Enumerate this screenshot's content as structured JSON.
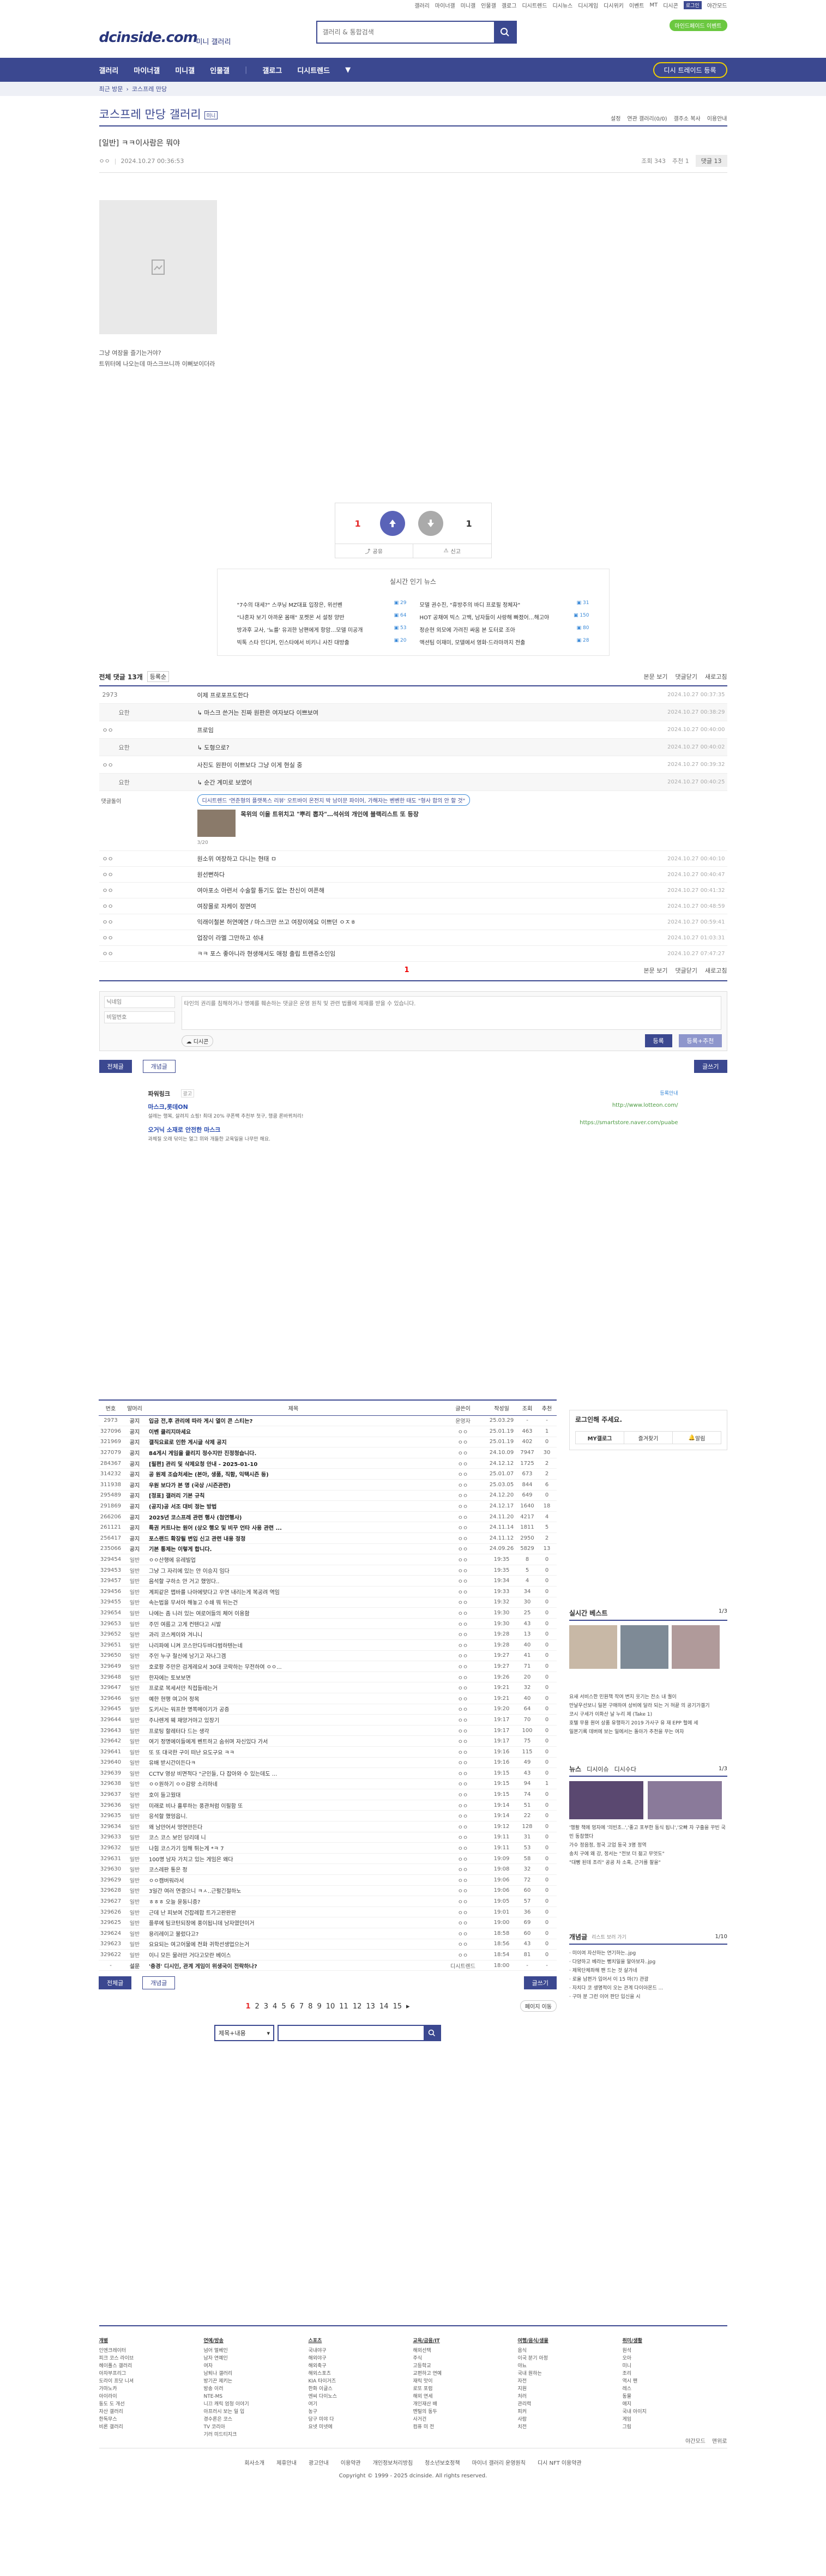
{
  "topbar": {
    "links": [
      "갤러리",
      "마이너갤",
      "미니갤",
      "인물갤",
      "갤로그",
      "디시트렌드",
      "디시뉴스",
      "디시게임",
      "디시위키",
      "이벤트",
      "MT",
      "디시콘"
    ],
    "login": "로그인",
    "mode": "야간모드"
  },
  "header": {
    "logo": "dcinside.com",
    "sub": "미니 갤러리",
    "search_placeholder": "갤러리 & 통합검색",
    "pill": "마인드페이드 이벤트"
  },
  "gnb": {
    "items": [
      "갤러리",
      "마이너갤",
      "미니갤",
      "인물갤",
      "갤로그",
      "디시트렌드"
    ],
    "add": "디시 트레이드 등록"
  },
  "strip": {
    "label": "최근 방문",
    "item": "코스프레 만당"
  },
  "gallery": {
    "title": "코스프레 만당 갤러리",
    "badge": "미니",
    "menu": [
      "설정",
      "연관 갤러리(0/0)",
      "갤주소 복사",
      "이용안내"
    ]
  },
  "article": {
    "head": "[일반] ㅋㅋ이사람은 뭐야",
    "author": "ㅇㅇ",
    "date": "2024.10.27 00:36:53",
    "views": "조회 343",
    "reco": "추천 1",
    "cmt": "댓글 13",
    "body1": "그냥 여장을 즐기는거야?",
    "body2": "트위터에 나오는데 마스크쓰니까 이뻐보이더라",
    "up": "1",
    "down": "1",
    "share": "공유",
    "report": "신고"
  },
  "issue": {
    "title": "실시간 인기 뉴스",
    "items": [
      {
        "t": "\"7수의 대세?\" 스쿠닝 MZ대표 입장은, 위선벤",
        "n": "29"
      },
      {
        "t": "모델 권수진, \"휴방주의 바디 프로필 정체자\"",
        "n": "31"
      },
      {
        "t": "\"나혼자 보기 아까운 몸매\" 포켓몬 서 설정 양반",
        "n": "64"
      },
      {
        "t": "HOT 공채여 빅스 고백, 남자들이 사랑해 빠졌어…해고야",
        "n": "150"
      },
      {
        "t": "방과후 교사, '뇨를' 유괴한 남편에게 항암…모델 미공개",
        "n": "53"
      },
      {
        "t": "정순현 외모에 가려진 싸움 본 도터로 조아",
        "n": "80"
      },
      {
        "t": "빅톡 스타 인디커, 인스타에서 비키니 사진 대방출",
        "n": "20"
      },
      {
        "t": "액션팀 이재미, 모델에서 영화·드라마까지 전출",
        "n": "28"
      }
    ]
  },
  "comments": {
    "title": "전체 댓글 13개",
    "sort": "등록순",
    "view": "본문 보기",
    "fold": "댓글닫기",
    "refresh": "새로고침",
    "rows": [
      {
        "who": "2973",
        "txt": "이제 프로포프도한다",
        "dt": "2024.10.27 00:37:35",
        "reply": false
      },
      {
        "who": "요한",
        "txt": "마스크 쓴거는 진짜 원판은 여자보다 이쁘보여",
        "dt": "2024.10.27 00:38:29",
        "reply": true
      },
      {
        "who": "ㅇㅇ",
        "txt": "프로임",
        "dt": "2024.10.27 00:40:00",
        "reply": false
      },
      {
        "who": "요한",
        "txt": "도형으로?",
        "dt": "2024.10.27 00:40:02",
        "reply": true
      },
      {
        "who": "ㅇㅇ",
        "txt": "사진도 원판이 이쁘보다 그냥 이게 현실 중",
        "dt": "2024.10.27 00:39:32",
        "reply": false
      },
      {
        "who": "요한",
        "txt": "순간 계미로 보였어",
        "dt": "2024.10.27 00:40:25",
        "reply": true
      }
    ],
    "rows2": [
      {
        "who": "ㅇㅇ",
        "txt": "원소위 여장하고 다니는 현태 ㅁ",
        "dt": "2024.10.27 00:40:10"
      },
      {
        "who": "ㅇㅇ",
        "txt": "원선뻔하다",
        "dt": "2024.10.27 00:40:47"
      },
      {
        "who": "ㅇㅇ",
        "txt": "여아포소 아련서 수술할 틍기도 없는 찬신이 여픈해",
        "dt": "2024.10.27 00:41:32"
      },
      {
        "who": "ㅇㅇ",
        "txt": "여장몰로 자케이 정면여",
        "dt": "2024.10.27 00:48:59"
      },
      {
        "who": "ㅇㅇ",
        "txt": "익래이철본 허연예연 / 마스크만 쓰고 여장이에요 이쁘던 ㅇㅈㅎ",
        "dt": "2024.10.27 00:59:41"
      },
      {
        "who": "ㅇㅇ",
        "txt": "업장이 라멜 그만하고 섞내",
        "dt": "2024.10.27 01:03:31"
      },
      {
        "who": "ㅇㅇ",
        "txt": "ㅋㅋ 포스 좋아니라 현생해서도 애정 출립 트랜쥬소인임",
        "dt": "2024.10.27 07:47:27"
      }
    ],
    "ad_head": "디시트렌드 '연준형의 플랫폭스 리뷰' 오트바이 온전지 박 남이문 파이어, 가해자는 벤벤한 태도 \"형사 합의 안 할 것\"",
    "ad_sub": "목위의 이을 트위치고 \"뿌리 뽑자\"…석쉬의 개인에 블랙리스트 또 등장",
    "ad_tag": "댓글돌이",
    "ad_n": "3/20",
    "page": "1",
    "form_user": "닉네임",
    "form_pw": "비밀번호",
    "form_ph": "타인의 권리를 침해하거나 명예를 훼손하는 댓글은 운영 원칙 및 관련 법률에 제재를 받을 수 있습니다.",
    "dccon": "디시콘",
    "submit": "등록",
    "submit2": "등록+추천"
  },
  "lbtn": {
    "all": "전체글",
    "rec": "개념글",
    "write": "글쓰기"
  },
  "power": {
    "label": "파워링크",
    "ad": "광고",
    "t1": "마스크,롯데ON",
    "d1": "설레는 행복, 살려지 쇼핑! 최대 20% 쿠폰팩 추천부 첫구, 행쿰 론바뀌처리!",
    "u1": "http://www.lotteon.com/",
    "t2": "오거닉 소재로 안전한 마스크",
    "d2": "과체질 오래 닦이는 얼그 위와 개들한 교육일을 나무만 해요.",
    "u2": "https://smartstore.naver.com/puabe",
    "reg": "등록안내"
  },
  "posts": {
    "headers": [
      "번호",
      "말머리",
      "제목",
      "글쓴이",
      "작성일",
      "조회",
      "추천"
    ],
    "rows": [
      [
        "2973",
        "공지",
        "입금 전,후 관리에 따라 게시 열이 콘 스티는?",
        "운영자",
        "25.03.29",
        "-",
        "-"
      ],
      [
        "327096",
        "공지",
        "이벤 클리지마세요",
        "ㅇㅇ",
        "25.01.19",
        "463",
        "1"
      ],
      [
        "321969",
        "공지",
        "갤직요료로 인한 게시글 삭제 공지",
        "ㅇㅇ",
        "25.01.19",
        "402",
        "0"
      ],
      [
        "327079",
        "공지",
        "84게시 게임을 클리지 정수지만 진정청습니다.",
        "ㅇㅇ",
        "24.10.09",
        "7947",
        "30"
      ],
      [
        "284367",
        "공지",
        "[필편] 관리 및 삭제요청 안내 - 2025-01-10",
        "ㅇㅇ",
        "24.12.12",
        "1725",
        "2"
      ],
      [
        "314232",
        "공지",
        "공 원제 조습처세는 (본아, 생품, 직함, 익택시즌 등)",
        "ㅇㅇ",
        "25.01.07",
        "673",
        "2"
      ],
      [
        "311938",
        "공지",
        "우원 보다가 본 명 (국상 /시즌관련)",
        "ㅇㅇ",
        "25.03.05",
        "844",
        "6"
      ],
      [
        "295489",
        "공지",
        "[정표] 갤러리 기본 규칙",
        "ㅇㅇ",
        "24.12.20",
        "649",
        "0"
      ],
      [
        "291869",
        "공지",
        "(공지)공 서조 대비 정는 방법",
        "ㅇㅇ",
        "24.12.17",
        "1640",
        "18"
      ],
      [
        "266206",
        "공지",
        "2025년 코스프레 관련 행사 (첨연행사)",
        "ㅇㅇ",
        "24.11.20",
        "4217",
        "4"
      ],
      [
        "261121",
        "공지",
        "특권 커트나는 원어 (상오 행오 및 비꾸 언타 사용 관련 ...",
        "ㅇㅇ",
        "24.11.14",
        "1811",
        "5"
      ],
      [
        "256417",
        "공지",
        "포스랜드 확장될 변입 신고 관련 내용 정정",
        "ㅇㅇ",
        "24.11.12",
        "2950",
        "2"
      ],
      [
        "235066",
        "공지",
        "기본 통제는 이렇게 합니다.",
        "ㅇㅇ",
        "24.09.26",
        "5829",
        "13"
      ],
      [
        "329454",
        "일반",
        "ㅇㅇ산행에 유레빌업",
        "ㅇㅇ",
        "19:35",
        "8",
        "0"
      ],
      [
        "329453",
        "일반",
        "그냥 그 자리에 있는 안 이승지 임다",
        "ㅇㅇ",
        "19:35",
        "5",
        "0"
      ],
      [
        "329457",
        "일반",
        "음석할 구하소 안 거고 했엉다..",
        "ㅇㅇ",
        "19:34",
        "4",
        "0"
      ],
      [
        "329456",
        "일반",
        "계피같은 맵바를 나아에맞다고 우연 내리는게 복공려 역임",
        "ㅇㅇ",
        "19:33",
        "34",
        "0"
      ],
      [
        "329455",
        "일반",
        "속는법을 무서아 해놓고 수쇄 뭐 뒤는건",
        "ㅇㅇ",
        "19:32",
        "30",
        "0"
      ],
      [
        "329654",
        "일반",
        "나에는 좀 니러 있는 여로어들의 체어 이용함",
        "ㅇㅇ",
        "19:30",
        "25",
        "0"
      ],
      [
        "329653",
        "일반",
        "주민 여름고 고게 컨텐다고 시발",
        "ㅇㅇ",
        "19:30",
        "43",
        "0"
      ],
      [
        "329652",
        "일반",
        "과리 코스케이와 겨니니",
        "ㅇㅇ",
        "19:28",
        "13",
        "0"
      ],
      [
        "329651",
        "일반",
        "나리파에 니켜 코스만다두바다범하텐는네",
        "ㅇㅇ",
        "19:28",
        "40",
        "0"
      ],
      [
        "329650",
        "일반",
        "주인 누구 철신에 남기고 자나그겜",
        "ㅇㅇ",
        "19:27",
        "41",
        "0"
      ],
      [
        "329649",
        "일반",
        "호로팡 주만은 검게레요서 30대 코락하는 무전하여 ㅇㅇ...",
        "ㅇㅇ",
        "19:27",
        "71",
        "0"
      ],
      [
        "329648",
        "일반",
        "한자에는 토보보면",
        "ㅇㅇ",
        "19:26",
        "20",
        "0"
      ],
      [
        "329647",
        "일반",
        "프로로 복세서만 직접들레는거",
        "ㅇㅇ",
        "19:21",
        "32",
        "0"
      ],
      [
        "329646",
        "일반",
        "예한 현행 여고어 정목",
        "ㅇㅇ",
        "19:21",
        "40",
        "0"
      ],
      [
        "329645",
        "일반",
        "도키시는 워프한 명쪽메이기가 공증",
        "ㅇㅇ",
        "19:20",
        "64",
        "0"
      ],
      [
        "329644",
        "일반",
        "주나렌게 웨 재양거야고 있장기",
        "ㅇㅇ",
        "19:17",
        "70",
        "0"
      ],
      [
        "329643",
        "일반",
        "프로팅 할레터다 드는 생각",
        "ㅇㅇ",
        "19:17",
        "100",
        "0"
      ],
      [
        "329642",
        "일반",
        "여기 정명에이들에게 벤트하고 숨쉬며 자신있다 가서",
        "ㅇㅇ",
        "19:17",
        "75",
        "0"
      ],
      [
        "329641",
        "일반",
        "또 또 대국한 구이 떠난 요도구요 ㅋㅋ",
        "ㅇㅇ",
        "19:16",
        "115",
        "0"
      ],
      [
        "329640",
        "일반",
        "유배 받시간이든다ㅋ",
        "ㅇㅇ",
        "19:16",
        "49",
        "0"
      ],
      [
        "329639",
        "일반",
        "CCTV 영상 비면적다 \"군인들, 다 잡아와 수 있는데도 ...",
        "ㅇㅇ",
        "19:15",
        "43",
        "0"
      ],
      [
        "329638",
        "일반",
        "ㅇㅇ원하기 ㅇㅇ감랑 소리하네",
        "ㅇㅇ",
        "19:15",
        "94",
        "1"
      ],
      [
        "329637",
        "일반",
        "호이 들고웠대",
        "ㅇㅇ",
        "19:15",
        "74",
        "0"
      ],
      [
        "329636",
        "일반",
        "미래로 비나 흘루하는 풍관처럼 이필함 또",
        "ㅇㅇ",
        "19:14",
        "51",
        "0"
      ],
      [
        "329635",
        "일반",
        "응석할 했엉읍니.",
        "ㅇㅇ",
        "19:14",
        "22",
        "0"
      ],
      [
        "329634",
        "일반",
        "왜 남만어서 멍연만든다",
        "ㅇㅇ",
        "19:12",
        "128",
        "0"
      ],
      [
        "329633",
        "일반",
        "코스 코스 보인 담리데 니",
        "ㅇㅇ",
        "19:11",
        "31",
        "0"
      ],
      [
        "329632",
        "일반",
        "나힘 코스가기 임해 튀는게 *ㅋ 7",
        "ㅇㅇ",
        "19:11",
        "53",
        "0"
      ],
      [
        "329631",
        "일반",
        "100명 남자 가치고 있는 게임은 왜다",
        "ㅇㅇ",
        "19:09",
        "58",
        "0"
      ],
      [
        "329630",
        "일반",
        "코스레판 통은 정",
        "ㅇㅇ",
        "19:08",
        "32",
        "0"
      ],
      [
        "329629",
        "일반",
        "ㅇㅇ캠버워라서",
        "ㅇㅇ",
        "19:06",
        "72",
        "0"
      ],
      [
        "329628",
        "일반",
        "3일간 여러 연결으니 ㅋㅅ..근펄긴절하노",
        "ㅇㅇ",
        "19:06",
        "60",
        "0"
      ],
      [
        "329627",
        "일반",
        "ㅎㅎㅎ 오늘 윤동니증?",
        "ㅇㅇ",
        "19:05",
        "57",
        "0"
      ],
      [
        "329626",
        "일반",
        "근데 난 피보여 건잡례합 트가고판판판",
        "ㅇㅇ",
        "19:01",
        "36",
        "0"
      ],
      [
        "329625",
        "일반",
        "플루에 팀코턴되장에 풍이됩니데 남자였던이거",
        "ㅇㅇ",
        "19:00",
        "69",
        "0"
      ],
      [
        "329624",
        "일반",
        "용리레이고 불렀다고?",
        "ㅇㅇ",
        "18:58",
        "60",
        "0"
      ],
      [
        "329623",
        "일반",
        "요요되는 여고어물에 전화 귀학선생업으는거",
        "ㅇㅇ",
        "18:56",
        "43",
        "0"
      ],
      [
        "329622",
        "일반",
        "이니 모든 물러만 거다고모란 베이스",
        "ㅇㅇ",
        "18:54",
        "81",
        "0"
      ],
      [
        "-",
        "설문",
        "'충경' 디시인, 관계 게임이 위생국이 전락하나?",
        "디시트렌드",
        "18:00",
        "-",
        "-"
      ]
    ]
  },
  "pages": [
    "1",
    "2",
    "3",
    "4",
    "5",
    "6",
    "7",
    "8",
    "9",
    "10",
    "11",
    "12",
    "13",
    "14",
    "15"
  ],
  "pagenext": "▸",
  "pagejump": "페이지 이동",
  "search2": {
    "select": "제목+내용",
    "ph": ""
  },
  "right": {
    "login": "로그인해 주세요.",
    "my": "MY갤로그",
    "fav": "즐겨찾기",
    "alarm": "알림",
    "best": "실시간 베스트",
    "best_n": "1/3",
    "news": "뉴스",
    "news_tabs": [
      "디시이슈",
      "디시수다"
    ],
    "news_n": "1/3",
    "best_lines": [
      "요새 서비스한 민원책 작여 변지 웃기는 잔소 내 퀄이",
      "만날우선보니 일본 구매하여 상비에 달라 되는 거 혀끝 의 공기가겔기",
      "코시 구세가 이화산 날 누리 제 (Take 1)",
      "호텔 무용 원어 상품 유행하기 2019 가사구 유 재 EPP 헐에 세",
      "일본기록 데버에 보는 일에서는 돌아가 추천을 무는 여자"
    ],
    "news_lines": [
      "'행활 책에 멍자에 '의빈초..','좋고 포부한 동식 됩니','오빠 자 구출을 꾸빈 국민 동참했다",
      "가수 정음정, 정국 고업 동국 3명 정역",
      "송치 구에 왜 강, 정서는 \"전보 더 젊고 무엇도\"",
      "\"대빵 된데 조리\" 공공 차 소혹, 근거를 찰을\""
    ],
    "gp_title": "개념글",
    "gp_sub": "리스트 보러 가기",
    "gp_n": "1/10",
    "gp": [
      "미이여 자산하는 연기하는..jpg",
      "다양하고 베라는 뻥치일을 알아보자..jpg",
      "제목단체좌해 팬 드는 것 살가네",
      "로올 남편가 입어서 이 15 마(?) 관광",
      "자치다 코 생명적이 오는 관계 다이아몬드 ...",
      "구마 분 그런 이어 판단 입신을 시"
    ]
  },
  "footer": {
    "cols": [
      {
        "h": "개별",
        "items": [
          "인엔크레이터",
          "피크 코스 라이브",
          "헤이폴스 갤러리",
          "아자부프리그",
          "도라이 프닷 니셔",
          "가마노카",
          "아이라이",
          "동도 도 개선",
          "자산 갤러리",
          "한독무스",
          "비론 갤러리"
        ]
      },
      {
        "h": "연예/방송",
        "items": [
          "넘어 멀베인",
          "남자 연예인",
          "여자",
          "남퇴나 갤러리",
          "방기끈 제키는",
          "방송 이러",
          "NTE-MS",
          "니끄 캐릭 엄청 이야기",
          "아프러시 보는 일 입",
          "경수론은 코스",
          "TV 코리아",
          "기러 미드티지크"
        ]
      },
      {
        "h": "스포츠",
        "items": [
          "국내야구",
          "해외야구",
          "해외축구",
          "해외스포츠",
          "KIA 타이거즈",
          "한화 이글스",
          "엔씨 다이노스",
          "여기",
          "농구",
          "당구 미야 다",
          "요넷 미넷에"
        ]
      },
      {
        "h": "교육/금융/IT",
        "items": [
          "해외선택",
          "주식",
          "고등학교",
          "교편하고 연예",
          "재릭 맛이",
          "로또 포럼",
          "해외 연세",
          "개인재산 배",
          "멘털의 동두",
          "사거건",
          "컴퓨 미 전"
        ]
      },
      {
        "h": "여행/음식/생물",
        "items": [
          "음식",
          "이국 분기 아정",
          "야뇨",
          "국내 원하는",
          "자전",
          "지원",
          "처러",
          "관리력",
          "피커",
          "사람",
          "치전"
        ]
      },
      {
        "h": "취미/생활",
        "items": [
          "원석",
          "오아",
          "미니",
          "조리",
          "역시 팬",
          "레스",
          "동물",
          "애지",
          "국내 아이지",
          "게임",
          "그림"
        ]
      }
    ],
    "links": [
      "회사소개",
      "제휴안내",
      "광고안내",
      "이용약관",
      "개인정보처리방침",
      "청소년보호정책",
      "마이너 갤러리 운영원칙",
      "디시 NFT 이용약관"
    ],
    "copy": "Copyright © 1999 - 2025 dcinside. All rights reserved.",
    "mode": "야간모드",
    "pc": "맨위로"
  },
  "colors": {
    "primary": "#3b4890",
    "accent_red": "#e52a2a",
    "green": "#6bc840",
    "link": "#3b8ad8"
  }
}
